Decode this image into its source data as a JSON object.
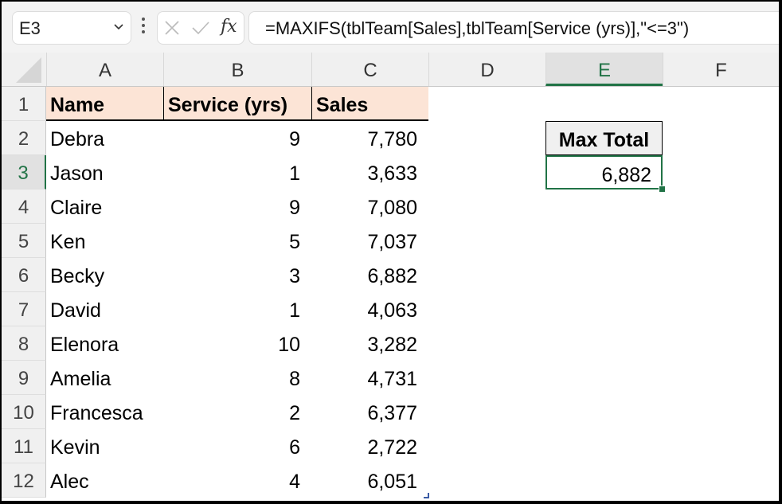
{
  "formula_bar": {
    "name_box": "E3",
    "formula": "=MAXIFS(tblTeam[Sales],tblTeam[Service (yrs)],\"<=3\")",
    "fx_label": "fx",
    "cancel_icon": "close-icon",
    "enter_icon": "check-icon"
  },
  "columns": [
    "A",
    "B",
    "C",
    "D",
    "E",
    "F"
  ],
  "selected_column": "E",
  "rows": [
    "1",
    "2",
    "3",
    "4",
    "5",
    "6",
    "7",
    "8",
    "9",
    "10",
    "11",
    "12"
  ],
  "selected_row": "3",
  "table": {
    "name": "tblTeam",
    "headers": [
      "Name",
      "Service (yrs)",
      "Sales"
    ],
    "rows": [
      [
        "Debra",
        "9",
        "7,780"
      ],
      [
        "Jason",
        "1",
        "3,633"
      ],
      [
        "Claire",
        "9",
        "7,080"
      ],
      [
        "Ken",
        "5",
        "7,037"
      ],
      [
        "Becky",
        "3",
        "6,882"
      ],
      [
        "David",
        "1",
        "4,063"
      ],
      [
        "Elenora",
        "10",
        "3,282"
      ],
      [
        "Amelia",
        "8",
        "4,731"
      ],
      [
        "Francesca",
        "2",
        "6,377"
      ],
      [
        "Kevin",
        "6",
        "2,722"
      ],
      [
        "Alec",
        "4",
        "6,051"
      ]
    ]
  },
  "result": {
    "label": "Max Total",
    "value": "6,882"
  },
  "colors": {
    "accent": "#217346",
    "table_header_fill": "#fce4d6"
  }
}
